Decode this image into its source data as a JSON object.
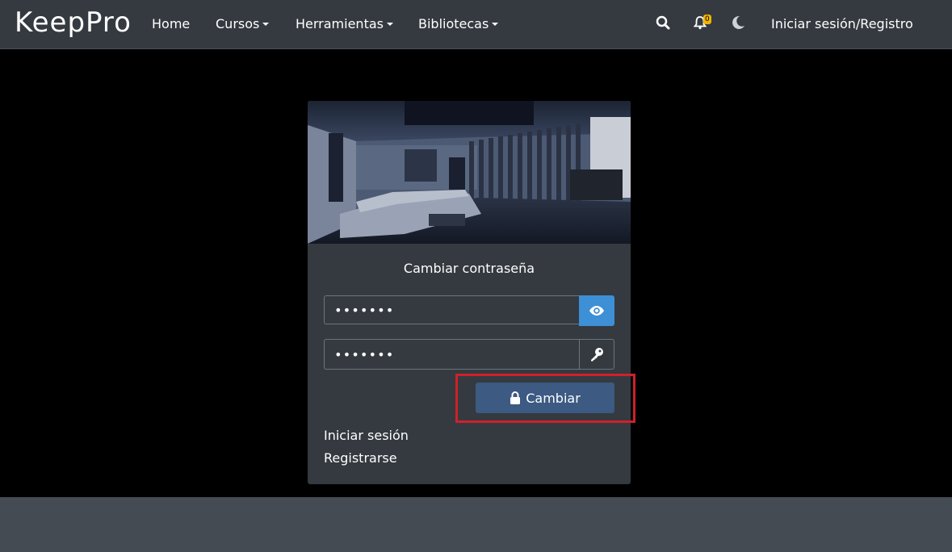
{
  "navbar": {
    "brand": "KeepPro",
    "links": [
      {
        "label": "Home"
      },
      {
        "label": "Cursos"
      },
      {
        "label": "Herramientas"
      },
      {
        "label": "Bibliotecas"
      }
    ],
    "notification_count": "0",
    "auth_link": "Iniciar sesión/Registro",
    "icons": [
      "search-icon",
      "bell-icon",
      "moon-icon"
    ]
  },
  "card": {
    "title": "Cambiar contraseña",
    "password_field": {
      "value": "•••••••"
    },
    "confirm_field": {
      "value": "•••••••"
    },
    "submit_label": "Cambiar",
    "links": {
      "login": "Iniciar sesión",
      "register": "Registrarse"
    }
  },
  "colors": {
    "navbar_bg": "#343a40",
    "card_bg": "#343a40",
    "eye_button": "#3d8fd6",
    "submit_button": "#3c5a82",
    "highlight": "#d0202a",
    "badge": "#f0b400"
  }
}
